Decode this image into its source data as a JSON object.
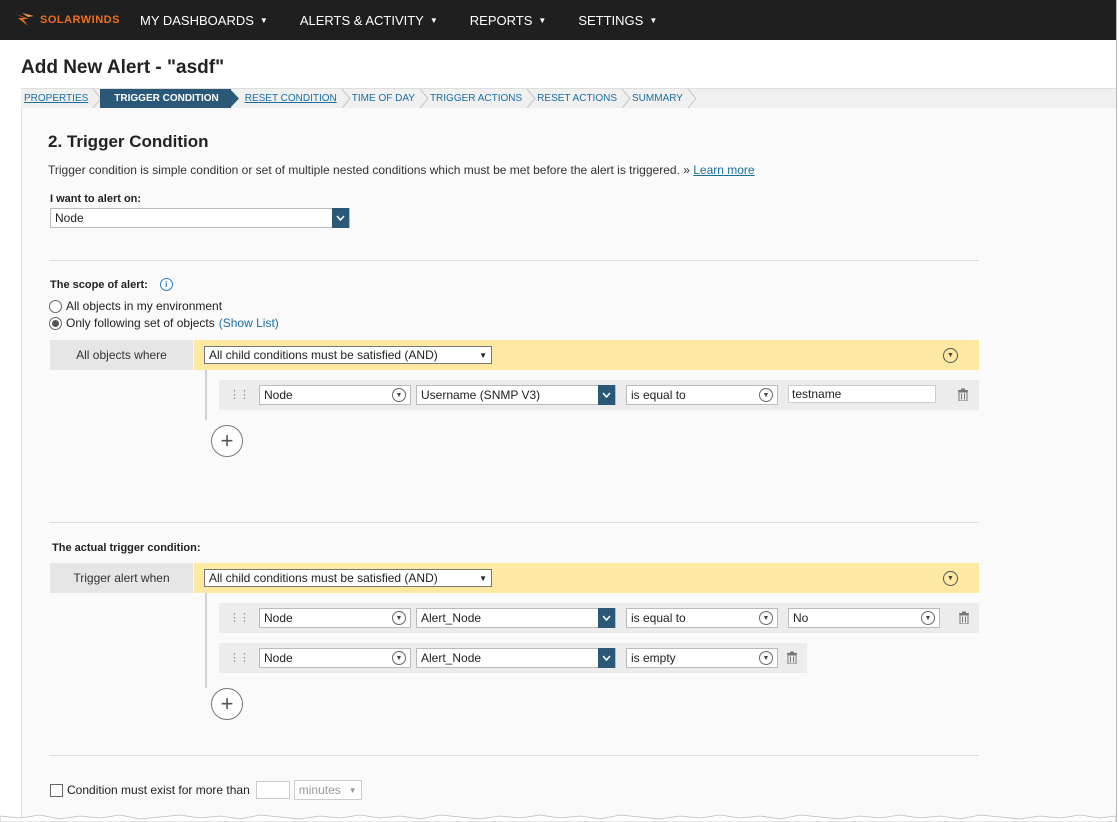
{
  "nav": {
    "brand": "SOLARWINDS",
    "items": [
      {
        "label": "MY DASHBOARDS"
      },
      {
        "label": "ALERTS & ACTIVITY"
      },
      {
        "label": "REPORTS"
      },
      {
        "label": "SETTINGS"
      }
    ]
  },
  "page": {
    "title": "Add New Alert - \"asdf\""
  },
  "wizard": {
    "steps": [
      {
        "label": "PROPERTIES"
      },
      {
        "label": "TRIGGER CONDITION"
      },
      {
        "label": "RESET CONDITION"
      },
      {
        "label": "TIME OF DAY"
      },
      {
        "label": "TRIGGER ACTIONS"
      },
      {
        "label": "RESET ACTIONS"
      },
      {
        "label": "SUMMARY"
      }
    ]
  },
  "section": {
    "title": "2. Trigger Condition",
    "description": "Trigger condition is simple condition or set of multiple nested conditions which must be met before the alert is triggered. »",
    "learn_more": "Learn more"
  },
  "alert_on": {
    "label": "I want to alert on:",
    "value": "Node"
  },
  "scope": {
    "label": "The scope of alert:",
    "option_all": "All objects in my environment",
    "option_set": "Only following set of objects",
    "show_list": "(Show List)",
    "where_label": "All objects where",
    "group_operator": "All child conditions must be satisfied (AND)",
    "rows": [
      {
        "entity": "Node",
        "field": "Username (SNMP V3)",
        "operator": "is equal to",
        "value": "testname"
      }
    ]
  },
  "trigger": {
    "label": "The actual trigger condition:",
    "where_label": "Trigger alert when",
    "group_operator": "All child conditions must be satisfied (AND)",
    "rows": [
      {
        "entity": "Node",
        "field": "Alert_Node",
        "operator": "is equal to",
        "value": "No"
      },
      {
        "entity": "Node",
        "field": "Alert_Node",
        "operator": "is empty"
      }
    ]
  },
  "duration": {
    "label": "Condition must exist for more than",
    "unit": "minutes"
  }
}
